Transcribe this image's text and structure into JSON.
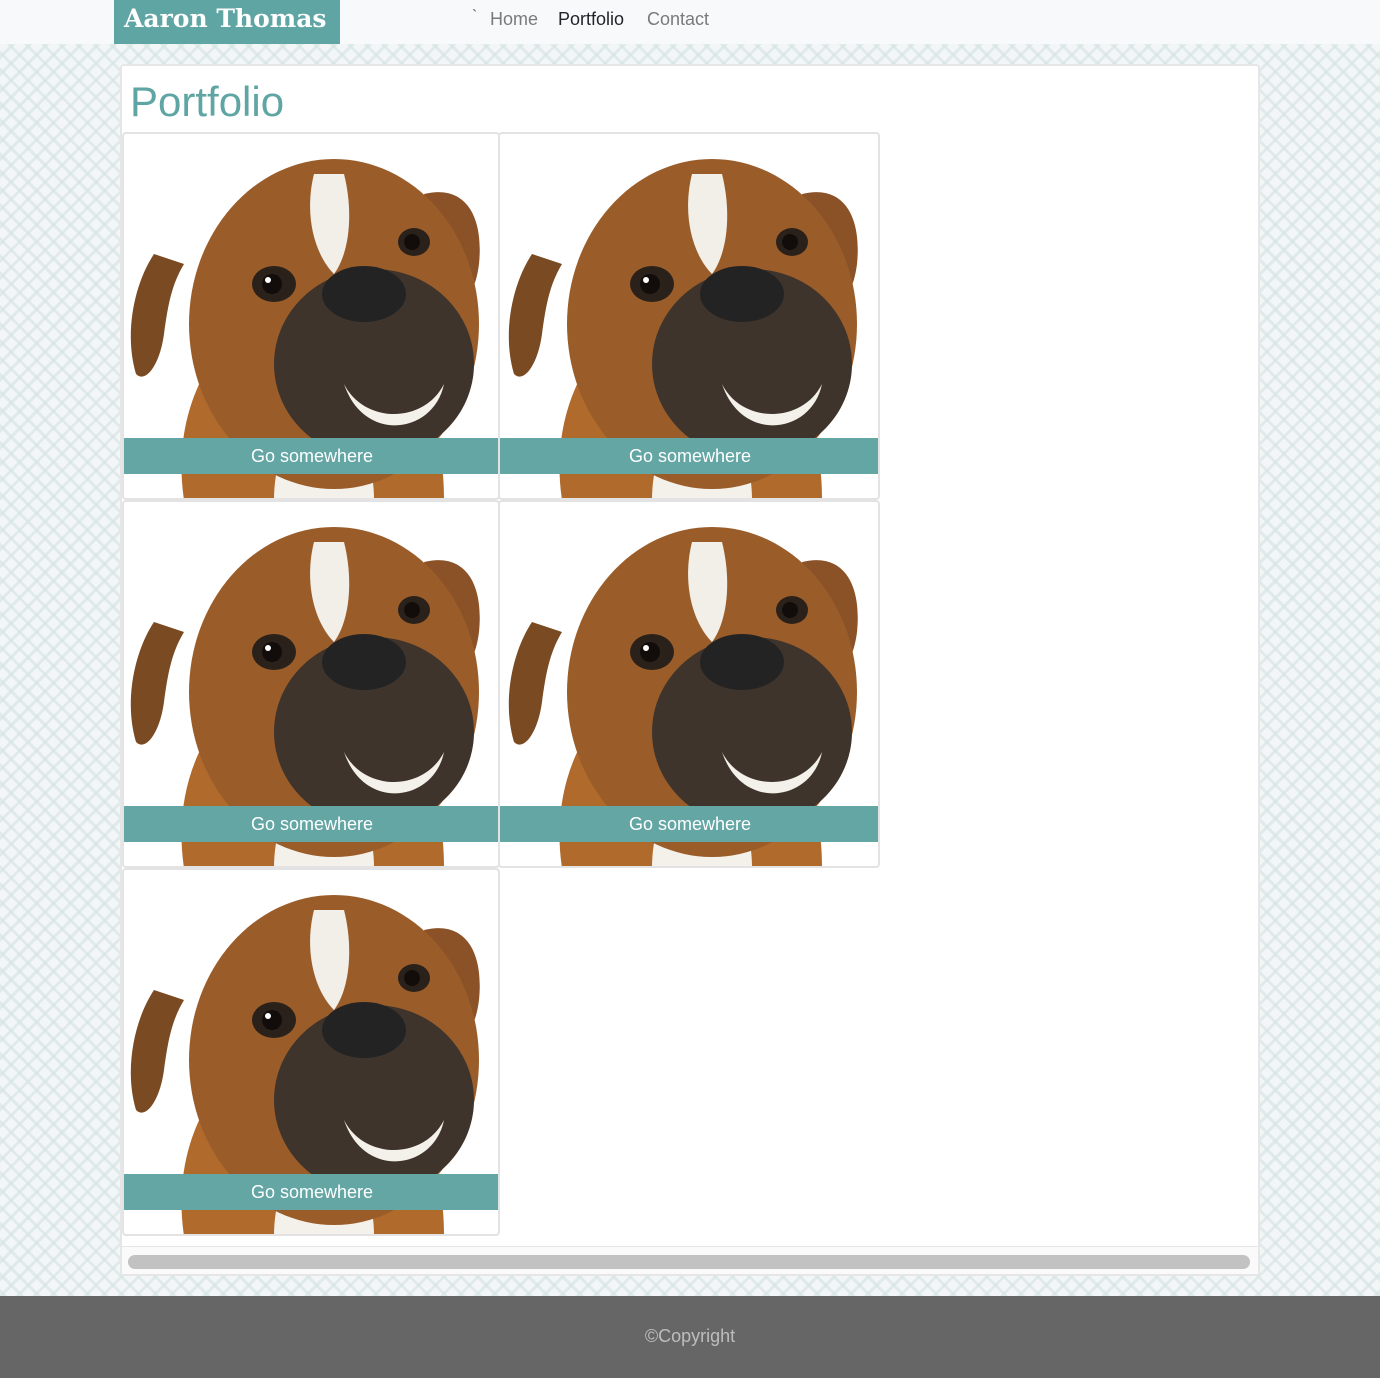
{
  "header": {
    "brand": "Aaron Thomas",
    "tick": "`",
    "nav": [
      {
        "label": "Home",
        "active": false
      },
      {
        "label": "Portfolio",
        "active": true
      },
      {
        "label": "Contact",
        "active": false
      }
    ]
  },
  "main": {
    "title": "Portfolio",
    "cards": [
      {
        "button_label": "Go somewhere",
        "image": "boxer-dog-photo"
      },
      {
        "button_label": "Go somewhere",
        "image": "boxer-dog-photo"
      },
      {
        "button_label": "Go somewhere",
        "image": "boxer-dog-photo"
      },
      {
        "button_label": "Go somewhere",
        "image": "boxer-dog-photo"
      },
      {
        "button_label": "Go somewhere",
        "image": "boxer-dog-photo"
      }
    ]
  },
  "footer": {
    "copyright": "©Copyright"
  },
  "colors": {
    "accent": "#5fa5a3",
    "footer_bg": "#666666"
  }
}
